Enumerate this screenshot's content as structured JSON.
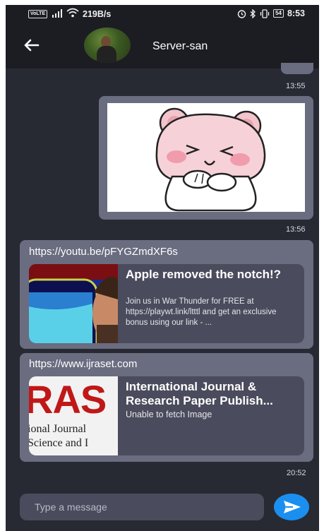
{
  "status_bar": {
    "volte": "VoLTE",
    "net_speed": "219B/s",
    "battery": "54",
    "time": "8:53"
  },
  "header": {
    "title": "Server-san"
  },
  "messages": [
    {
      "time": "13:55"
    },
    {
      "type": "sticker",
      "time": "13:56"
    },
    {
      "type": "link",
      "url": "https://youtu.be/pFYGZmdXF6s",
      "preview_title": "Apple removed the notch!?",
      "preview_description": "Join us in War Thunder for FREE at https://playwt.link/ltttl and get an exclusive bonus using our link - ..."
    },
    {
      "type": "link",
      "url": "https://www.ijraset.com",
      "preview_title": "International Journal & Research Paper Publish...",
      "preview_description": "Unable to fetch Image",
      "thumb_text_1": "RAS",
      "thumb_text_2": "ional Journal",
      "thumb_text_3": "Science and I",
      "time": "20:52"
    }
  ],
  "composer": {
    "placeholder": "Type a message"
  },
  "colors": {
    "background": "#282a33",
    "bar": "#1c1d23",
    "bubble": "#6a6c80",
    "card": "#4a4b5c",
    "send": "#1a8ff0"
  }
}
